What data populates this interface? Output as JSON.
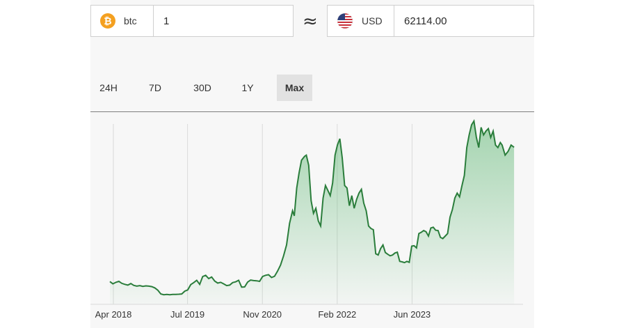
{
  "converter": {
    "from": {
      "symbol": "btc",
      "icon": "bitcoin-icon",
      "amount": "1"
    },
    "approx_symbol": "≈",
    "to": {
      "symbol": "USD",
      "icon": "us-flag-icon",
      "amount": "62114.00"
    }
  },
  "tabs": [
    {
      "label": "24H"
    },
    {
      "label": "7D"
    },
    {
      "label": "30D"
    },
    {
      "label": "1Y"
    },
    {
      "label": "Max",
      "active": true
    }
  ],
  "colors": {
    "line": "#2a7d3b",
    "fill": "#5fb774",
    "bitcoin": "#f4a020"
  },
  "chart_data": {
    "type": "area",
    "x_ticks": [
      "Apr 2018",
      "Jul 2019",
      "Nov 2020",
      "Feb 2022",
      "Jun 2023"
    ],
    "x_range": [
      2018.0,
      2024.9
    ],
    "y_range": [
      0,
      73000
    ],
    "ylabel": "",
    "grid": "vertical",
    "series": [
      {
        "values": [
          [
            2018.0,
            9000
          ],
          [
            2018.05,
            8100
          ],
          [
            2018.1,
            8700
          ],
          [
            2018.15,
            9100
          ],
          [
            2018.2,
            8300
          ],
          [
            2018.25,
            7900
          ],
          [
            2018.3,
            7600
          ],
          [
            2018.35,
            8200
          ],
          [
            2018.4,
            7500
          ],
          [
            2018.45,
            7200
          ],
          [
            2018.5,
            7400
          ],
          [
            2018.55,
            7100
          ],
          [
            2018.6,
            7300
          ],
          [
            2018.65,
            7200
          ],
          [
            2018.7,
            7000
          ],
          [
            2018.75,
            6500
          ],
          [
            2018.8,
            5600
          ],
          [
            2018.85,
            4100
          ],
          [
            2018.9,
            3800
          ],
          [
            2018.95,
            3900
          ],
          [
            2019.0,
            3800
          ],
          [
            2019.05,
            3900
          ],
          [
            2019.1,
            3950
          ],
          [
            2019.15,
            4000
          ],
          [
            2019.2,
            4100
          ],
          [
            2019.25,
            5200
          ],
          [
            2019.3,
            5700
          ],
          [
            2019.35,
            7800
          ],
          [
            2019.4,
            8600
          ],
          [
            2019.45,
            9500
          ],
          [
            2019.5,
            7900
          ],
          [
            2019.55,
            11000
          ],
          [
            2019.6,
            11500
          ],
          [
            2019.65,
            10200
          ],
          [
            2019.7,
            10800
          ],
          [
            2019.75,
            9200
          ],
          [
            2019.8,
            8400
          ],
          [
            2019.85,
            8700
          ],
          [
            2019.9,
            8100
          ],
          [
            2019.95,
            7400
          ],
          [
            2020.0,
            7600
          ],
          [
            2020.05,
            8600
          ],
          [
            2020.1,
            8900
          ],
          [
            2020.15,
            9500
          ],
          [
            2020.2,
            6800
          ],
          [
            2020.25,
            6900
          ],
          [
            2020.3,
            8800
          ],
          [
            2020.35,
            9600
          ],
          [
            2020.4,
            9400
          ],
          [
            2020.45,
            9300
          ],
          [
            2020.5,
            9100
          ],
          [
            2020.55,
            11000
          ],
          [
            2020.6,
            11500
          ],
          [
            2020.65,
            11700
          ],
          [
            2020.7,
            10600
          ],
          [
            2020.75,
            11100
          ],
          [
            2020.8,
            13100
          ],
          [
            2020.85,
            15500
          ],
          [
            2020.9,
            19200
          ],
          [
            2020.95,
            23500
          ],
          [
            2021.0,
            32000
          ],
          [
            2021.05,
            37000
          ],
          [
            2021.08,
            35000
          ],
          [
            2021.12,
            46000
          ],
          [
            2021.16,
            52000
          ],
          [
            2021.2,
            57000
          ],
          [
            2021.25,
            58500
          ],
          [
            2021.28,
            59000
          ],
          [
            2021.32,
            55000
          ],
          [
            2021.36,
            41000
          ],
          [
            2021.4,
            36000
          ],
          [
            2021.44,
            38000
          ],
          [
            2021.48,
            33000
          ],
          [
            2021.52,
            31000
          ],
          [
            2021.56,
            42000
          ],
          [
            2021.6,
            47000
          ],
          [
            2021.64,
            45000
          ],
          [
            2021.68,
            43000
          ],
          [
            2021.72,
            48000
          ],
          [
            2021.76,
            59000
          ],
          [
            2021.8,
            63000
          ],
          [
            2021.84,
            65500
          ],
          [
            2021.88,
            58000
          ],
          [
            2021.92,
            47000
          ],
          [
            2021.96,
            46000
          ],
          [
            2022.0,
            39000
          ],
          [
            2022.04,
            43000
          ],
          [
            2022.08,
            38000
          ],
          [
            2022.12,
            41500
          ],
          [
            2022.16,
            44000
          ],
          [
            2022.2,
            45500
          ],
          [
            2022.24,
            40000
          ],
          [
            2022.28,
            37000
          ],
          [
            2022.32,
            31000
          ],
          [
            2022.36,
            30000
          ],
          [
            2022.4,
            29500
          ],
          [
            2022.44,
            20000
          ],
          [
            2022.48,
            19500
          ],
          [
            2022.52,
            22000
          ],
          [
            2022.56,
            23500
          ],
          [
            2022.6,
            20500
          ],
          [
            2022.64,
            19800
          ],
          [
            2022.68,
            19200
          ],
          [
            2022.72,
            19500
          ],
          [
            2022.76,
            20300
          ],
          [
            2022.8,
            20600
          ],
          [
            2022.84,
            17000
          ],
          [
            2022.88,
            16800
          ],
          [
            2022.92,
            16500
          ],
          [
            2022.96,
            17000
          ],
          [
            2023.0,
            16600
          ],
          [
            2023.04,
            23000
          ],
          [
            2023.08,
            23200
          ],
          [
            2023.12,
            22300
          ],
          [
            2023.16,
            28000
          ],
          [
            2023.2,
            28500
          ],
          [
            2023.24,
            29200
          ],
          [
            2023.28,
            28700
          ],
          [
            2023.32,
            27000
          ],
          [
            2023.36,
            30200
          ],
          [
            2023.4,
            30500
          ],
          [
            2023.44,
            29300
          ],
          [
            2023.48,
            29200
          ],
          [
            2023.52,
            26500
          ],
          [
            2023.56,
            26000
          ],
          [
            2023.6,
            27000
          ],
          [
            2023.64,
            28000
          ],
          [
            2023.68,
            34500
          ],
          [
            2023.72,
            37500
          ],
          [
            2023.76,
            42000
          ],
          [
            2023.8,
            44000
          ],
          [
            2023.84,
            42500
          ],
          [
            2023.88,
            47000
          ],
          [
            2023.92,
            51000
          ],
          [
            2023.96,
            62000
          ],
          [
            2024.0,
            67000
          ],
          [
            2024.04,
            71000
          ],
          [
            2024.08,
            72500
          ],
          [
            2024.12,
            66000
          ],
          [
            2024.16,
            62000
          ],
          [
            2024.2,
            70000
          ],
          [
            2024.24,
            67000
          ],
          [
            2024.28,
            68500
          ],
          [
            2024.32,
            69500
          ],
          [
            2024.36,
            66000
          ],
          [
            2024.4,
            68500
          ],
          [
            2024.44,
            63000
          ],
          [
            2024.48,
            62000
          ],
          [
            2024.52,
            64000
          ],
          [
            2024.55,
            63000
          ],
          [
            2024.6,
            59000
          ],
          [
            2024.65,
            60500
          ],
          [
            2024.7,
            63000
          ],
          [
            2024.75,
            62114
          ]
        ]
      }
    ]
  }
}
